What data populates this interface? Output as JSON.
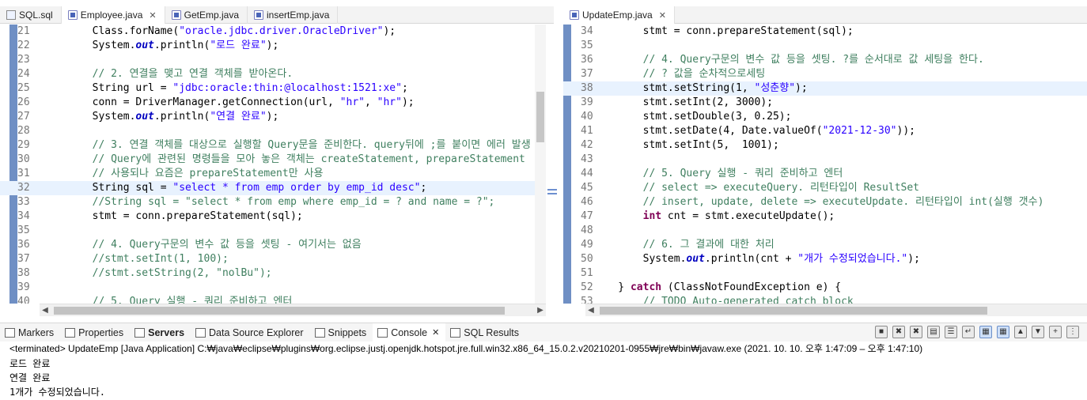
{
  "left_tabs": [
    {
      "label": "SQL.sql",
      "type": "sql",
      "active": false
    },
    {
      "label": "Employee.java",
      "type": "java",
      "active": true,
      "closable": true
    },
    {
      "label": "GetEmp.java",
      "type": "java",
      "active": false
    },
    {
      "label": "insertEmp.java",
      "type": "java",
      "active": false
    }
  ],
  "right_tabs": [
    {
      "label": "UpdateEmp.java",
      "type": "java",
      "active": true,
      "closable": true
    }
  ],
  "left_editor": {
    "lines": [
      {
        "n": "21",
        "text": "        Class.forName(\"oracle.jdbc.driver.OracleDriver\");"
      },
      {
        "n": "22",
        "text": "        System.out.println(\"로드 완료\");"
      },
      {
        "n": "23",
        "text": ""
      },
      {
        "n": "24",
        "text": "        // 2. 연결을 맺고 연결 객체를 받아온다."
      },
      {
        "n": "25",
        "text": "        String url = \"jdbc:oracle:thin:@localhost:1521:xe\";"
      },
      {
        "n": "26",
        "text": "        conn = DriverManager.getConnection(url, \"hr\", \"hr\");"
      },
      {
        "n": "27",
        "text": "        System.out.println(\"연결 완료\");"
      },
      {
        "n": "28",
        "text": ""
      },
      {
        "n": "29",
        "text": "        // 3. 연결 객체를 대상으로 실행할 Query문을 준비한다. query뒤에 ;를 붙이면 에러 발생"
      },
      {
        "n": "30",
        "text": "        // Query에 관련된 명령들을 모아 놓은 객체는 createStatement, prepareStatement"
      },
      {
        "n": "31",
        "text": "        // 사용되나 요즘은 prepareStatement만 사용"
      },
      {
        "n": "32",
        "text": "        String sql = \"select * from emp order by emp_id desc\";"
      },
      {
        "n": "33",
        "text": "        //String sql = \"select * from emp where emp_id = ? and name = ?\";"
      },
      {
        "n": "34",
        "text": "        stmt = conn.prepareStatement(sql);"
      },
      {
        "n": "35",
        "text": ""
      },
      {
        "n": "36",
        "text": "        // 4. Query구문의 변수 값 등을 셋팅 - 여기서는 없음"
      },
      {
        "n": "37",
        "text": "        //stmt.setInt(1, 100);"
      },
      {
        "n": "38",
        "text": "        //stmt.setString(2, \"nolBu\");"
      },
      {
        "n": "39",
        "text": ""
      },
      {
        "n": "40",
        "text": "        // 5. Query 실행 - 쿼리 준비하고 엔터"
      }
    ]
  },
  "right_editor": {
    "lines": [
      {
        "n": "34",
        "text": "        stmt = conn.prepareStatement(sql);"
      },
      {
        "n": "35",
        "text": ""
      },
      {
        "n": "36",
        "text": "        // 4. Query구문의 변수 값 등을 셋팅. ?를 순서대로 값 세팅을 한다."
      },
      {
        "n": "37",
        "text": "        // ? 값을 순차적으로세팅"
      },
      {
        "n": "38",
        "text": "        stmt.setString(1, \"성춘향\");"
      },
      {
        "n": "39",
        "text": "        stmt.setInt(2, 3000);"
      },
      {
        "n": "40",
        "text": "        stmt.setDouble(3, 0.25);"
      },
      {
        "n": "41",
        "text": "        stmt.setDate(4, Date.valueOf(\"2021-12-30\"));"
      },
      {
        "n": "42",
        "text": "        stmt.setInt(5,  1001);"
      },
      {
        "n": "43",
        "text": ""
      },
      {
        "n": "44",
        "text": "        // 5. Query 실행 - 쿼리 준비하고 엔터"
      },
      {
        "n": "45",
        "text": "        // select => executeQuery. 리턴타입이 ResultSet"
      },
      {
        "n": "46",
        "text": "        // insert, update, delete => executeUpdate. 리턴타입이 int(실행 갯수)"
      },
      {
        "n": "47",
        "text": "        int cnt = stmt.executeUpdate();"
      },
      {
        "n": "48",
        "text": ""
      },
      {
        "n": "49",
        "text": "        // 6. 그 결과에 대한 처리"
      },
      {
        "n": "50",
        "text": "        System.out.println(cnt + \"개가 수정되었습니다.\");"
      },
      {
        "n": "51",
        "text": ""
      },
      {
        "n": "52",
        "text": "    } catch (ClassNotFoundException e) {"
      },
      {
        "n": "53",
        "text": "        // TODO Auto-generated catch block"
      }
    ]
  },
  "console_tabs": [
    {
      "label": "Markers",
      "bold": false
    },
    {
      "label": "Properties",
      "bold": false
    },
    {
      "label": "Servers",
      "bold": true
    },
    {
      "label": "Data Source Explorer",
      "bold": false
    },
    {
      "label": "Snippets",
      "bold": false
    },
    {
      "label": "Console",
      "bold": false,
      "active": true,
      "closable": true
    },
    {
      "label": "SQL Results",
      "bold": false
    }
  ],
  "console": {
    "status": "<terminated> UpdateEmp [Java Application] C:₩java₩eclipse₩plugins₩org.eclipse.justj.openjdk.hotspot.jre.full.win32.x86_64_15.0.2.v20210201-0955₩jre₩bin₩javaw.exe  (2021. 10. 10. 오후 1:47:09 – 오후 1:47:10)",
    "output": [
      "로드 완료",
      "연결 완료",
      "1개가 수정되었습니다."
    ]
  }
}
